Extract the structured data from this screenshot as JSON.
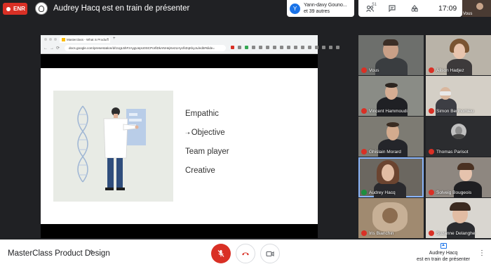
{
  "topbar": {
    "rec_label": "ENR",
    "presenter_title": "Audrey Hacq est en train de présenter",
    "participants_pill": {
      "avatar_letter": "Y",
      "line1": "Yann-davy Gouno...",
      "line2": "et 39 autres"
    },
    "controls": {
      "people_icon": "people-icon",
      "people_count": "51",
      "chat_icon": "chat-icon",
      "activities_icon": "shapes-icon",
      "time": "17:09"
    },
    "self_view_label": "Vous"
  },
  "shared_screen": {
    "tab_label": "Masterclass - What is Product",
    "url": "docs.google.com/presentation/d/1UgL5hFzAygUepU0SCPorfiDkANHejKe2LHycfiIZqKkyJu/edit#slide=",
    "slide_items": [
      "Empathic",
      "Objective",
      "Team player",
      "Creative"
    ],
    "selected_item_index": 1
  },
  "participants": [
    {
      "name": "Vous",
      "muted": true
    },
    {
      "name": "Alison Hadjez",
      "muted": true
    },
    {
      "name": "Vincent Hammoudi",
      "muted": true
    },
    {
      "name": "Simon Berthomieu",
      "muted": true
    },
    {
      "name": "Ghislain Morard",
      "muted": true
    },
    {
      "name": "Thomas Parisot",
      "muted": true
    },
    {
      "name": "Audrey Hacq",
      "muted": false,
      "active": true
    },
    {
      "name": "Solveig Bougeois",
      "muted": true
    },
    {
      "name": "Iris Bianchin",
      "muted": true
    },
    {
      "name": "Suzanne Delanghe",
      "muted": true
    }
  ],
  "bottombar": {
    "meeting_name": "MasterClass Product Design",
    "present_line1": "Audrey Hacq",
    "present_line2": "est en train de présenter"
  },
  "colors": {
    "accent_red": "#d93025",
    "accent_blue": "#1a73e8",
    "dark_bg": "#202124"
  }
}
